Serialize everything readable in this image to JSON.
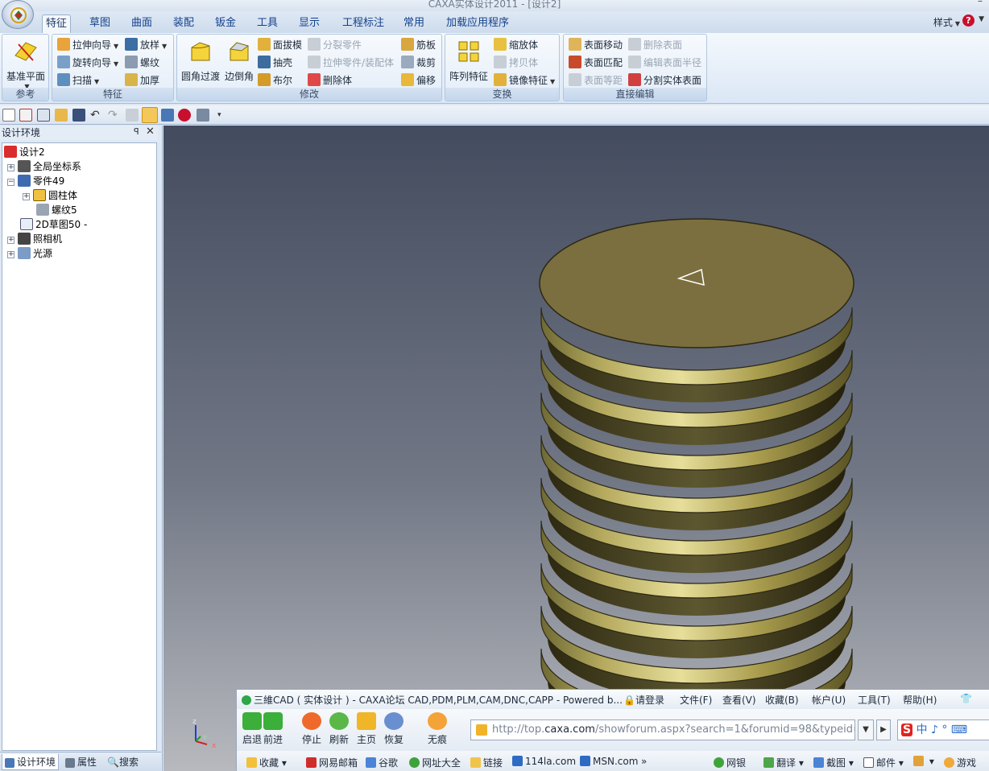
{
  "window": {
    "title": "CAXA实体设计2011 - [设计2]",
    "minimize": "–"
  },
  "tabs": [
    "特征",
    "草图",
    "曲面",
    "装配",
    "钣金",
    "工具",
    "显示",
    "工程标注",
    "常用",
    "加载应用程序"
  ],
  "style_menu": "样式",
  "help_label": "?",
  "ribbon": {
    "reference": {
      "label": "参考",
      "btn": "基准平面"
    },
    "feature": {
      "label": "特征",
      "items": [
        "拉伸向导",
        "旋转向导",
        "扫描",
        "放样",
        "螺纹",
        "加厚"
      ]
    },
    "modify": {
      "label": "修改",
      "large": [
        "圆角过渡",
        "边倒角"
      ],
      "items": [
        "面拔模",
        "抽壳",
        "布尔",
        "分裂零件",
        "拉伸零件/装配体",
        "删除体",
        "筋板",
        "裁剪",
        "偏移"
      ]
    },
    "transform": {
      "label": "变换",
      "large": "阵列特征",
      "items": [
        "缩放体",
        "拷贝体",
        "镜像特征"
      ]
    },
    "direct_edit": {
      "label": "直接编辑",
      "items": [
        "表面移动",
        "表面匹配",
        "表面等距",
        "删除表面",
        "编辑表面半径",
        "分割实体表面"
      ]
    }
  },
  "panel": {
    "title": "设计环境",
    "pin": "ꟼ",
    "close": "✕",
    "tree": [
      {
        "label": "设计2"
      },
      {
        "label": "全局坐标系"
      },
      {
        "label": "零件49"
      },
      {
        "label": "圆柱体"
      },
      {
        "label": "螺纹5"
      },
      {
        "label": "2D草图50 -"
      },
      {
        "label": "照相机"
      },
      {
        "label": "光源"
      }
    ],
    "tabs": [
      "设计环境",
      "属性",
      "搜索"
    ]
  },
  "axis": {
    "x": "x",
    "y": "y",
    "z": "z"
  },
  "browser": {
    "title": "三維CAD ( 实体设计 ) - CAXA论坛 CAD,PDM,PLM,CAM,DNC,CAPP - Powered b...",
    "login": "请登录",
    "menu": [
      "文件(F)",
      "查看(V)",
      "收藏(B)",
      "帐户(U)",
      "工具(T)",
      "帮助(H)"
    ],
    "nav": [
      "启退",
      "前进",
      "停止",
      "刷新",
      "主页",
      "恢复",
      "无痕"
    ],
    "url_prefix": "http://top.",
    "url_domain": "caxa.com",
    "url_suffix": "/showforum.aspx?search=1&forumid=98&typeid=0",
    "ime": "中 ♪ ° ⌨",
    "ime_brand": "S",
    "favorites": [
      "收藏",
      "网易邮箱",
      "谷歌",
      "网址大全",
      "链接",
      "114la.com",
      "MSN.com",
      "»"
    ],
    "right_tools": [
      "网银",
      "翻译",
      "截图",
      "邮件",
      "游戏"
    ]
  }
}
